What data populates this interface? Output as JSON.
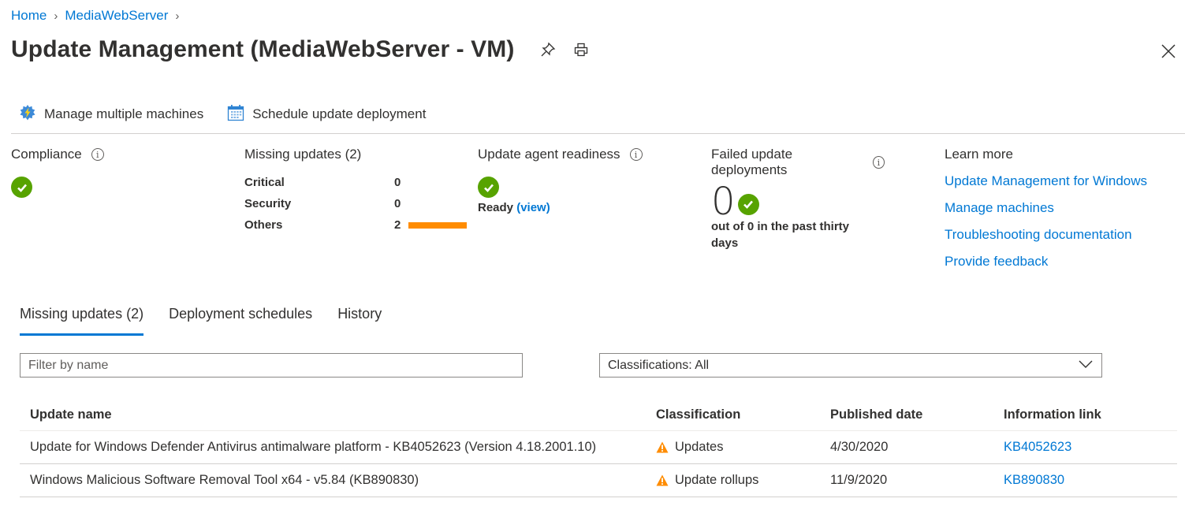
{
  "breadcrumb": [
    {
      "label": "Home"
    },
    {
      "label": "MediaWebServer"
    }
  ],
  "header": {
    "title": "Update Management (MediaWebServer - VM)",
    "icons": [
      "pin-icon",
      "print-icon",
      "close-icon"
    ]
  },
  "toolbar": {
    "manage_label": "Manage multiple machines",
    "schedule_label": "Schedule update deployment"
  },
  "summary": {
    "compliance": {
      "title": "Compliance",
      "status": "compliant"
    },
    "missing": {
      "title": "Missing updates (2)",
      "rows": [
        {
          "label": "Critical",
          "value": "0",
          "fraction": 0
        },
        {
          "label": "Security",
          "value": "0",
          "fraction": 0
        },
        {
          "label": "Others",
          "value": "2",
          "fraction": 1
        }
      ],
      "bar_color": "#ff8c00"
    },
    "readiness": {
      "title": "Update agent readiness",
      "status_text": "Ready",
      "link_text": "(view)"
    },
    "failed": {
      "title": "Failed update deployments",
      "count": "0",
      "subtitle": "out of 0 in the past thirty days"
    },
    "learn_more": {
      "title": "Learn more",
      "links": [
        "Update Management for Windows",
        "Manage machines",
        "Troubleshooting documentation",
        "Provide feedback"
      ]
    }
  },
  "tabs": [
    {
      "label": "Missing updates (2)",
      "active": true
    },
    {
      "label": "Deployment schedules",
      "active": false
    },
    {
      "label": "History",
      "active": false
    }
  ],
  "filter": {
    "placeholder": "Filter by name",
    "value": ""
  },
  "classification_select": {
    "value": "Classifications: All"
  },
  "table": {
    "columns": [
      "Update name",
      "Classification",
      "Published date",
      "Information link"
    ],
    "rows": [
      {
        "name": "Update for Windows Defender Antivirus antimalware platform - KB4052623 (Version 4.18.2001.10)",
        "classification": "Updates",
        "published": "4/30/2020",
        "link": "KB4052623"
      },
      {
        "name": "Windows Malicious Software Removal Tool x64 - v5.84 (KB890830)",
        "classification": "Update rollups",
        "published": "11/9/2020",
        "link": "KB890830"
      }
    ]
  },
  "colors": {
    "accent": "#0078d4",
    "success": "#57a300",
    "warning": "#ff8c00"
  }
}
